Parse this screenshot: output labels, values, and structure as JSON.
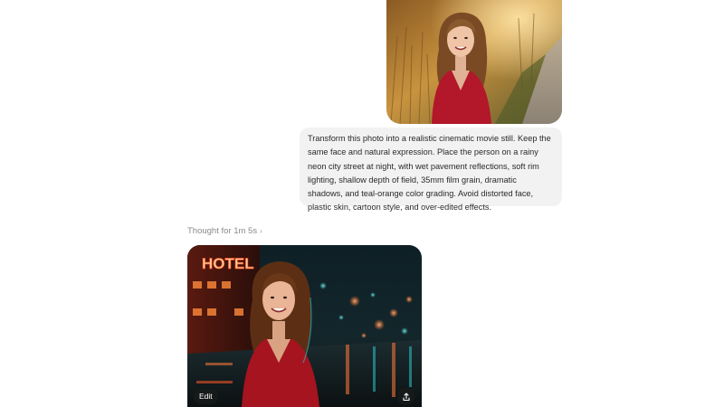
{
  "conversation": {
    "user_message": {
      "image_alt": "Portrait of a smiling woman in a red dress outdoors",
      "text": "Transform this photo into a realistic cinematic movie still. Keep the same face and natural expression. Place the person on a rainy neon city street at night, with wet pavement reflections, soft rim lighting, shallow depth of field, 35mm film grain, dramatic shadows, and teal-orange color grading. Avoid distorted face, plastic skin, cartoon style, and over-edited effects."
    },
    "assistant_message": {
      "thought_label": "Thought for 1m 5s",
      "thought_chevron_icon": "chevron-right-icon",
      "generated_image_sign": "HOTEL",
      "edit_label": "Edit",
      "share_icon": "share-icon"
    }
  },
  "colors": {
    "bubble_bg": "#f2f2f2",
    "thought_text": "#8a8a8a",
    "dress_red": "#b3172a",
    "neon_orange": "#ff6a2a",
    "neon_teal": "#29c7c9"
  }
}
